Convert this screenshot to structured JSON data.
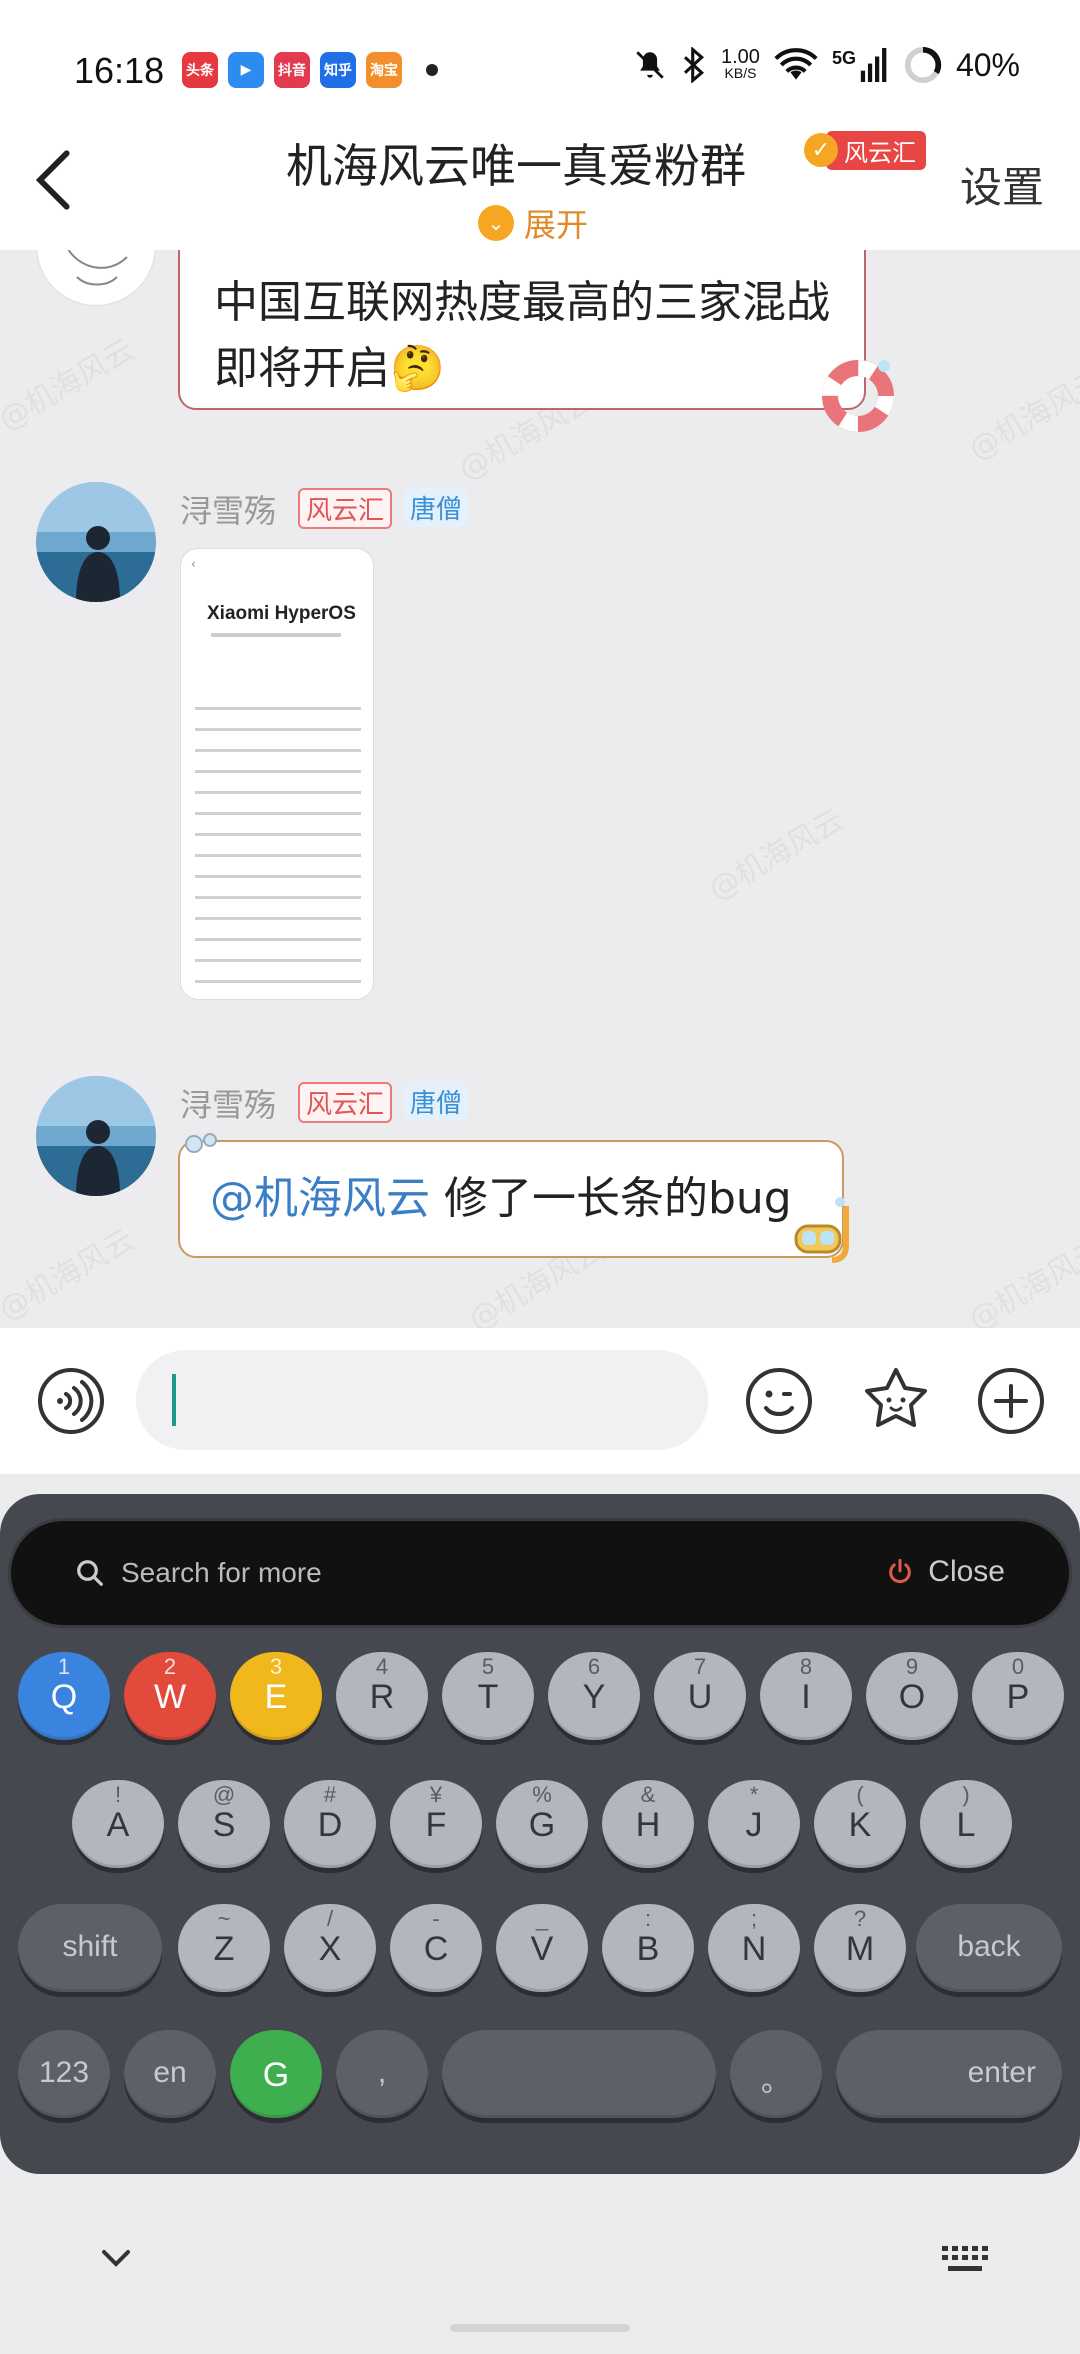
{
  "status_bar": {
    "time": "16:18",
    "apps": [
      {
        "name": "toutiao-icon",
        "label": "头条",
        "color": "#e6393f"
      },
      {
        "name": "share-icon",
        "label": "▶",
        "color": "#2d8cf0"
      },
      {
        "name": "douyin-mall-icon",
        "label": "抖音",
        "color": "#e23b50"
      },
      {
        "name": "zhihu-icon",
        "label": "知乎",
        "color": "#1f6fe6"
      },
      {
        "name": "taobao-flash-icon",
        "label": "淘宝",
        "color": "#f28f2c"
      }
    ],
    "net_speed_value": "1.00",
    "net_speed_unit": "KB/S",
    "network": "5G",
    "battery": "40%"
  },
  "header": {
    "back": "‹",
    "title": "机海风云唯一真爱粉群",
    "badge_label": "风云汇",
    "settings": "设置",
    "expand": "展开"
  },
  "messages": [
    {
      "type": "text",
      "text": "中国互联网热度最高的三家混战即将开启🤔"
    },
    {
      "type": "image",
      "sender": "浔雪殇",
      "tag1": "风云汇",
      "tag2": "唐僧",
      "image": {
        "title": "Xiaomi HyperOS"
      }
    },
    {
      "type": "text",
      "sender": "浔雪殇",
      "tag1": "风云汇",
      "tag2": "唐僧",
      "mention": "@机海风云",
      "text": " 修了一长条的bug"
    }
  ],
  "watermark": "@机海风云",
  "input": {
    "placeholder": ""
  },
  "keyboard": {
    "search_placeholder": "Search for more",
    "close_label": "Close",
    "row1": [
      {
        "letter": "Q",
        "hint": "1",
        "color": "#3a84e0"
      },
      {
        "letter": "W",
        "hint": "2",
        "color": "#e24b3b"
      },
      {
        "letter": "E",
        "hint": "3",
        "color": "#f0b81c"
      },
      {
        "letter": "R",
        "hint": "4"
      },
      {
        "letter": "T",
        "hint": "5"
      },
      {
        "letter": "Y",
        "hint": "6"
      },
      {
        "letter": "U",
        "hint": "7"
      },
      {
        "letter": "I",
        "hint": "8"
      },
      {
        "letter": "O",
        "hint": "9"
      },
      {
        "letter": "P",
        "hint": "0"
      }
    ],
    "row2": [
      {
        "letter": "A",
        "hint": "!"
      },
      {
        "letter": "S",
        "hint": "@"
      },
      {
        "letter": "D",
        "hint": "#"
      },
      {
        "letter": "F",
        "hint": "¥"
      },
      {
        "letter": "G",
        "hint": "%"
      },
      {
        "letter": "H",
        "hint": "&"
      },
      {
        "letter": "J",
        "hint": "*"
      },
      {
        "letter": "K",
        "hint": "("
      },
      {
        "letter": "L",
        "hint": ")"
      }
    ],
    "row3": [
      {
        "letter": "Z",
        "hint": "~"
      },
      {
        "letter": "X",
        "hint": "/"
      },
      {
        "letter": "C",
        "hint": "-"
      },
      {
        "letter": "V",
        "hint": "_"
      },
      {
        "letter": "B",
        "hint": ":"
      },
      {
        "letter": "N",
        "hint": ";"
      },
      {
        "letter": "M",
        "hint": "?"
      }
    ],
    "shift": "shift",
    "back": "back",
    "num": "123",
    "lang": "en",
    "g": "G",
    "comma": ",",
    "period": "。",
    "enter": "enter"
  }
}
